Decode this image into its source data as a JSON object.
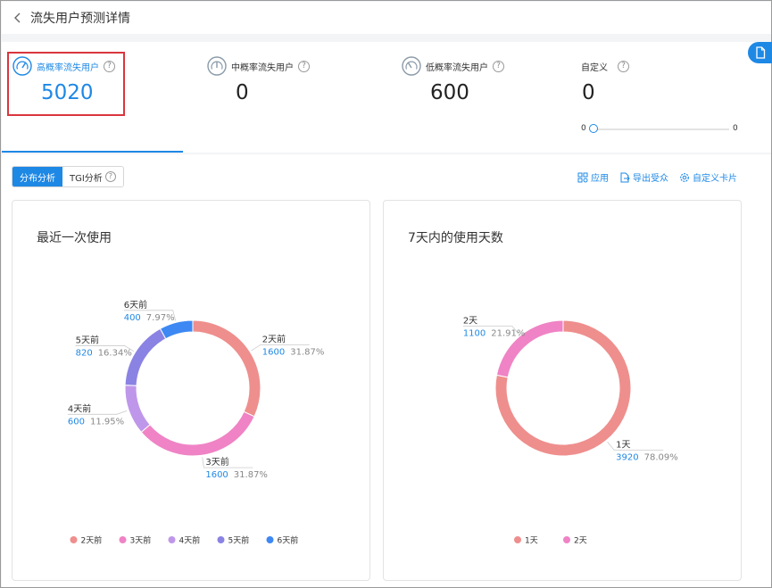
{
  "header": {
    "title": "流失用户预测详情"
  },
  "stats": [
    {
      "label": "高概率流失用户",
      "value": "5020",
      "active": true
    },
    {
      "label": "中概率流失用户",
      "value": "0",
      "active": false
    },
    {
      "label": "低概率流失用户",
      "value": "600",
      "active": false
    },
    {
      "label": "自定义",
      "value": "0",
      "active": false
    }
  ],
  "slider": {
    "min": "0",
    "max": "0",
    "value": 0
  },
  "tabs": [
    {
      "label": "分布分析",
      "active": true
    },
    {
      "label": "TGI分析",
      "active": false
    }
  ],
  "actions": {
    "apply": "应用",
    "export": "导出受众",
    "custom_card": "自定义卡片"
  },
  "colors": {
    "accent": "#1e88e5",
    "alert_outline": "#d9363e"
  },
  "chart_data": [
    {
      "type": "pie",
      "title": "最近一次使用",
      "categories": [
        "2天前",
        "3天前",
        "4天前",
        "5天前",
        "6天前"
      ],
      "values": [
        1600,
        1600,
        600,
        820,
        400
      ],
      "percents": [
        "31.87%",
        "31.87%",
        "11.95%",
        "16.34%",
        "7.97%"
      ],
      "colors": [
        "#ee8f8d",
        "#ef83c5",
        "#bf97ea",
        "#8a83e3",
        "#3d88f3"
      ],
      "legend_position": "bottom"
    },
    {
      "type": "pie",
      "title": "7天内的使用天数",
      "categories": [
        "1天",
        "2天"
      ],
      "values": [
        3920,
        1100
      ],
      "percents": [
        "78.09%",
        "21.91%"
      ],
      "colors": [
        "#ee8f8d",
        "#ef83c5"
      ],
      "legend_position": "bottom"
    }
  ]
}
